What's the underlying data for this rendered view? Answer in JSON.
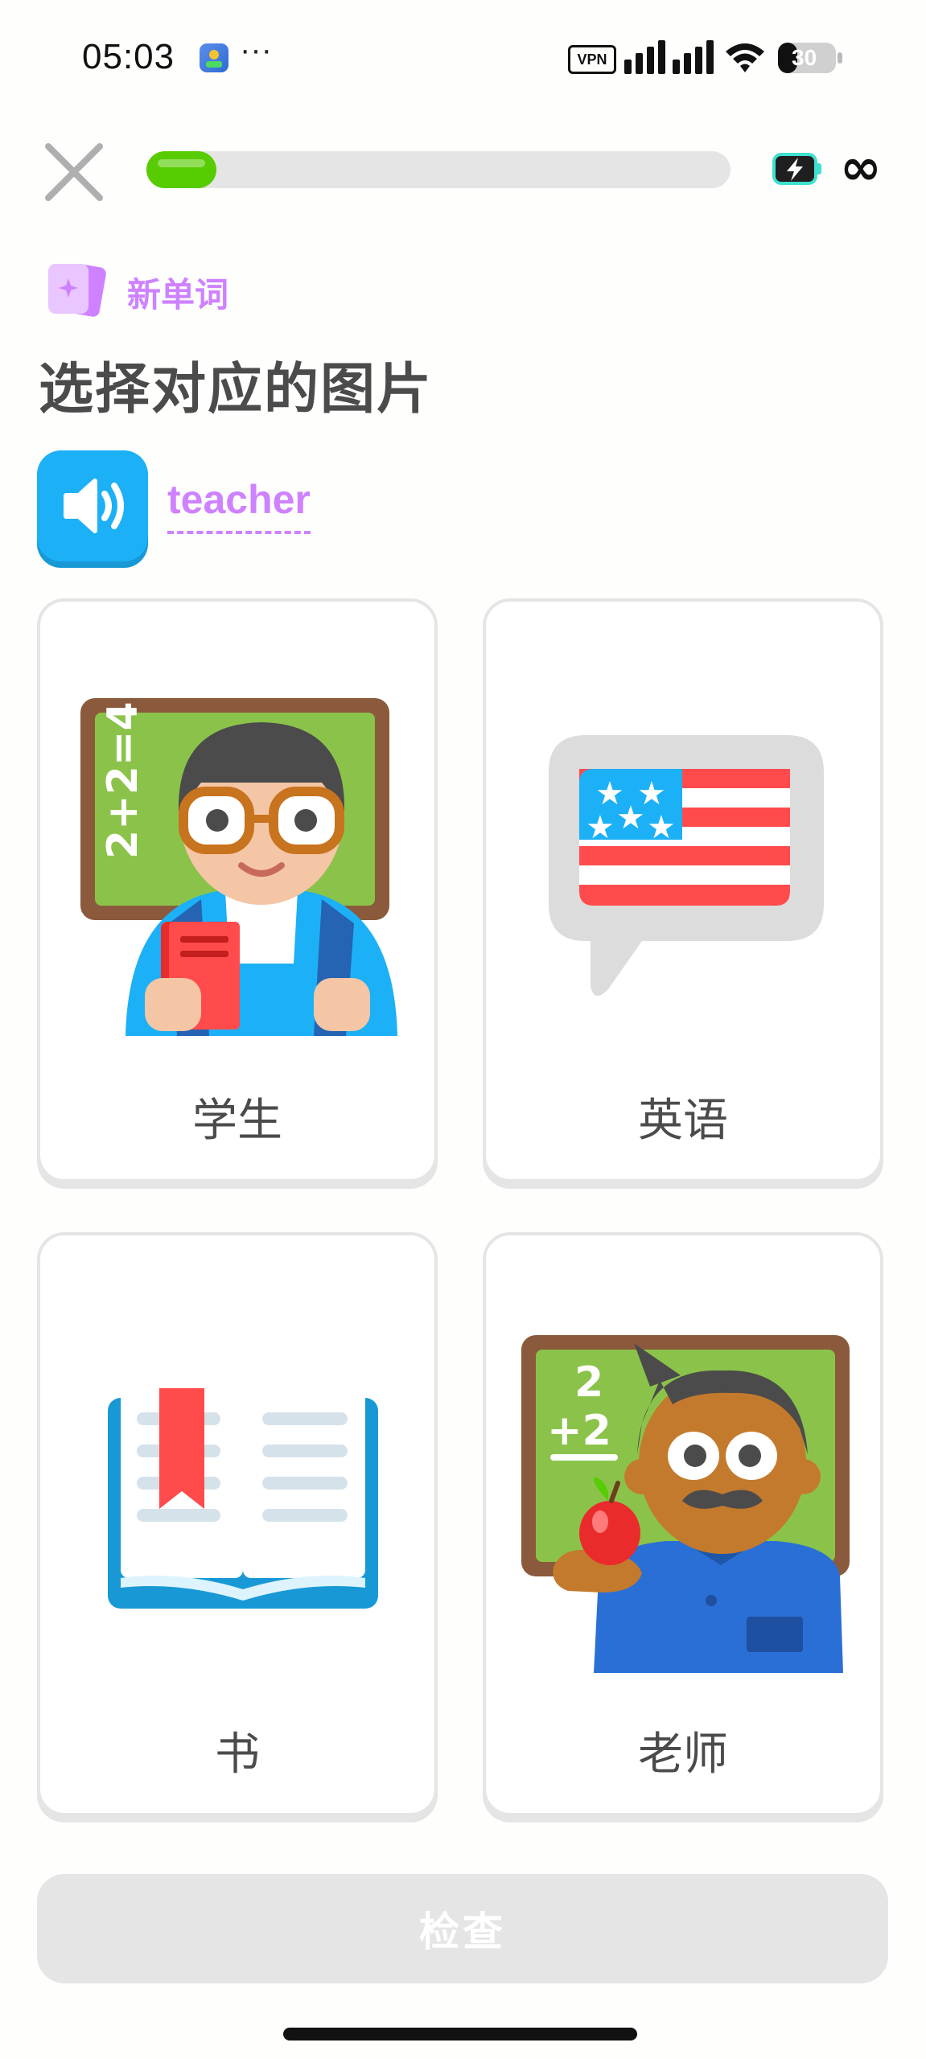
{
  "status_bar": {
    "time": "05:03",
    "dots": "···",
    "vpn": "VPN",
    "battery": "30"
  },
  "top_bar": {
    "progress": 0.12,
    "infinity": "∞"
  },
  "header": {
    "badge": "新单词",
    "title": "选择对应的图片",
    "word": "teacher"
  },
  "options": [
    {
      "label": "学生",
      "image": "student-illustration"
    },
    {
      "label": "英语",
      "image": "us-flag-speech-bubble"
    },
    {
      "label": "书",
      "image": "open-book"
    },
    {
      "label": "老师",
      "image": "teacher-illustration"
    }
  ],
  "footer": {
    "check": "检查"
  },
  "colors": {
    "accent_purple": "#ce82ff",
    "audio_blue": "#1cb0f6",
    "progress_green": "#58cc02",
    "disabled_gray": "#e5e5e5"
  }
}
